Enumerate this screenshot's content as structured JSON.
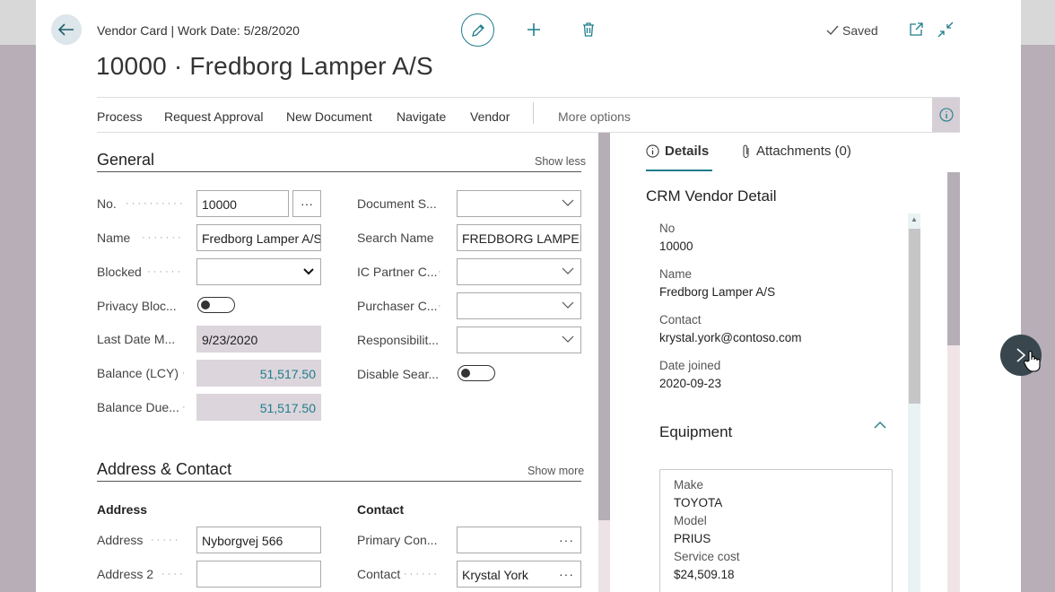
{
  "header": {
    "subtitle": "Vendor Card | Work Date: 5/28/2020",
    "title": "10000 · Fredborg Lamper A/S",
    "saved_label": "Saved"
  },
  "actions": [
    "Process",
    "Request Approval",
    "New Document",
    "Navigate",
    "Vendor",
    "More options"
  ],
  "general": {
    "title": "General",
    "toggle_label": "Show less",
    "left_fields": [
      {
        "label": "No.",
        "value": "10000"
      },
      {
        "label": "Name",
        "value": "Fredborg Lamper A/S"
      },
      {
        "label": "Blocked",
        "value": ""
      },
      {
        "label": "Privacy Bloc...",
        "value": "off"
      },
      {
        "label": "Last Date M...",
        "value": "9/23/2020"
      },
      {
        "label": "Balance (LCY)",
        "value": "51,517.50"
      },
      {
        "label": "Balance Due...",
        "value": "51,517.50"
      }
    ],
    "right_fields": [
      {
        "label": "Document S...",
        "value": ""
      },
      {
        "label": "Search Name",
        "value": "FREDBORG LAMPER"
      },
      {
        "label": "IC Partner C...",
        "value": ""
      },
      {
        "label": "Purchaser C...",
        "value": ""
      },
      {
        "label": "Responsibilit...",
        "value": ""
      },
      {
        "label": "Disable Sear...",
        "value": "off"
      }
    ]
  },
  "address_contact": {
    "title": "Address & Contact",
    "toggle_label": "Show more",
    "address_heading": "Address",
    "contact_heading": "Contact",
    "address_fields": [
      {
        "label": "Address",
        "value": "Nyborgvej 566"
      },
      {
        "label": "Address 2",
        "value": ""
      }
    ],
    "contact_fields": [
      {
        "label": "Primary Con...",
        "value": ""
      },
      {
        "label": "Contact",
        "value": "Krystal York"
      }
    ]
  },
  "factbox": {
    "tabs": {
      "details": "Details",
      "attachments": "Attachments (0)"
    },
    "title": "CRM Vendor Detail",
    "items": [
      {
        "label": "No",
        "value": "10000"
      },
      {
        "label": "Name",
        "value": "Fredborg Lamper A/S"
      },
      {
        "label": "Contact",
        "value": "krystal.york@contoso.com"
      },
      {
        "label": "Date joined",
        "value": "2020-09-23"
      }
    ],
    "equipment": {
      "title": "Equipment",
      "lines": [
        {
          "label": "Make",
          "value": "TOYOTA"
        },
        {
          "label": "Model",
          "value": "PRIUS"
        },
        {
          "label": "Service cost",
          "value": "$24,509.18"
        }
      ]
    }
  },
  "colors": {
    "accent": "#1f7d8c",
    "readonly_bg": "#dcd5dc",
    "backdrop": "#b6aeb6"
  }
}
